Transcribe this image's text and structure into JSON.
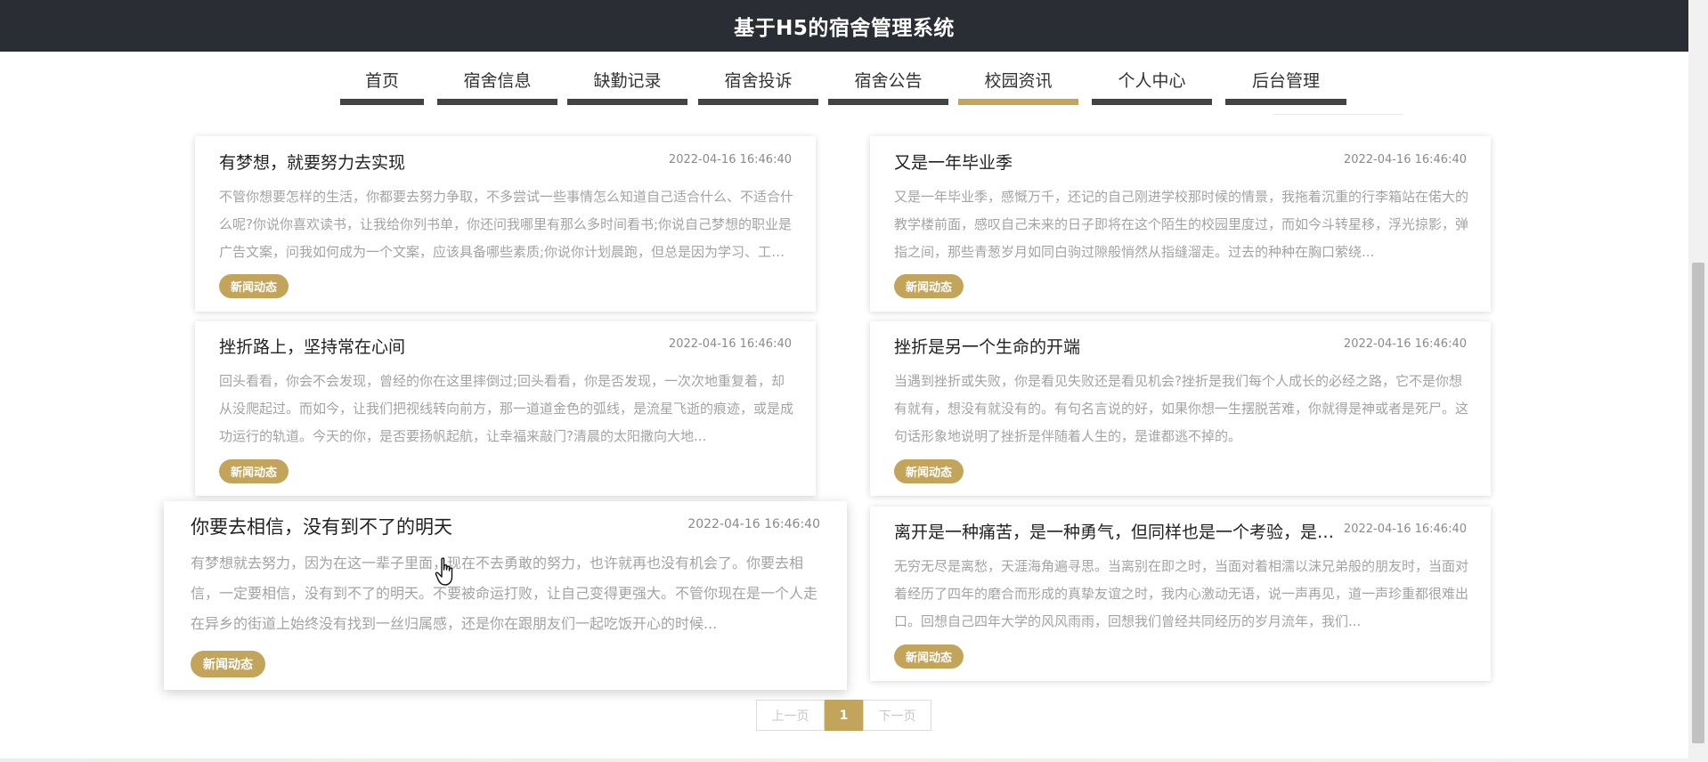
{
  "app": {
    "title": "基于H5的宿舍管理系统"
  },
  "nav": {
    "items": [
      {
        "label": "首页"
      },
      {
        "label": "宿舍信息"
      },
      {
        "label": "缺勤记录"
      },
      {
        "label": "宿舍投诉"
      },
      {
        "label": "宿舍公告"
      },
      {
        "label": "校园资讯"
      },
      {
        "label": "个人中心"
      },
      {
        "label": "后台管理"
      }
    ],
    "active": "校园资讯"
  },
  "news": [
    {
      "title": "有梦想，就要努力去实现",
      "date": "2022-04-16 16:46:40",
      "summary": "不管你想要怎样的生活，你都要去努力争取，不多尝试一些事情怎么知道自己适合什么、不适合什么呢?你说你喜欢读书，让我给你列书单，你还问我哪里有那么多时间看书;你说自己梦想的职业是广告文案，问我如何成为一个文案，应该具备哪些素质;你说你计划晨跑，但总是因为学习、工作太累没坚持下去...",
      "tag": "新闻动态"
    },
    {
      "title": "又是一年毕业季",
      "date": "2022-04-16 16:46:40",
      "summary": "又是一年毕业季，感慨万千，还记的自己刚进学校那时候的情景，我拖着沉重的行李箱站在偌大的教学楼前面，感叹自己未来的日子即将在这个陌生的校园里度过，而如今斗转星移，浮光掠影，弹指之间，那些青葱岁月如同白驹过隙般悄然从指缝溜走。过去的种种在胸口萦绕...",
      "tag": "新闻动态"
    },
    {
      "title": "挫折路上，坚持常在心间",
      "date": "2022-04-16 16:46:40",
      "summary": "回头看看，你会不会发现，曾经的你在这里摔倒过;回头看看，你是否发现，一次次地重复着，却从没爬起过。而如今，让我们把视线转向前方，那一道道金色的弧线，是流星飞逝的痕迹，或是成功运行的轨道。今天的你，是否要扬帆起航，让幸福来敲门?清晨的太阳撒向大地...",
      "tag": "新闻动态"
    },
    {
      "title": "挫折是另一个生命的开端",
      "date": "2022-04-16 16:46:40",
      "summary": "当遇到挫折或失败，你是看见失败还是看见机会?挫折是我们每个人成长的必经之路，它不是你想有就有，想没有就没有的。有句名言说的好，如果你想一生摆脱苦难，你就得是神或者是死尸。这句话形象地说明了挫折是伴随着人生的，是谁都逃不掉的。",
      "tag": "新闻动态"
    },
    {
      "title": "你要去相信，没有到不了的明天",
      "date": "2022-04-16 16:46:40",
      "summary": "有梦想就去努力，因为在这一辈子里面，现在不去勇敢的努力，也许就再也没有机会了。你要去相信，一定要相信，没有到不了的明天。不要被命运打败，让自己变得更强大。不管你现在是一个人走在异乡的街道上始终没有找到一丝归属感，还是你在跟朋友们一起吃饭开心的时候...",
      "tag": "新闻动态"
    },
    {
      "title": "离开是一种痛苦，是一种勇气，但同样也是一个考验，是一个新的开端",
      "date": "2022-04-16 16:46:40",
      "summary": "无穷无尽是离愁，天涯海角遍寻思。当离别在即之时，当面对着相濡以沫兄弟般的朋友时，当面对着经历了四年的磨合而形成的真挚友谊之时，我内心激动无语，说一声再见，道一声珍重都很难出口。回想自己四年大学的风风雨雨，回想我们曾经共同经历的岁月流年，我们...",
      "tag": "新闻动态"
    }
  ],
  "pagination": {
    "prev": "上一页",
    "current": "1",
    "next": "下一页"
  }
}
